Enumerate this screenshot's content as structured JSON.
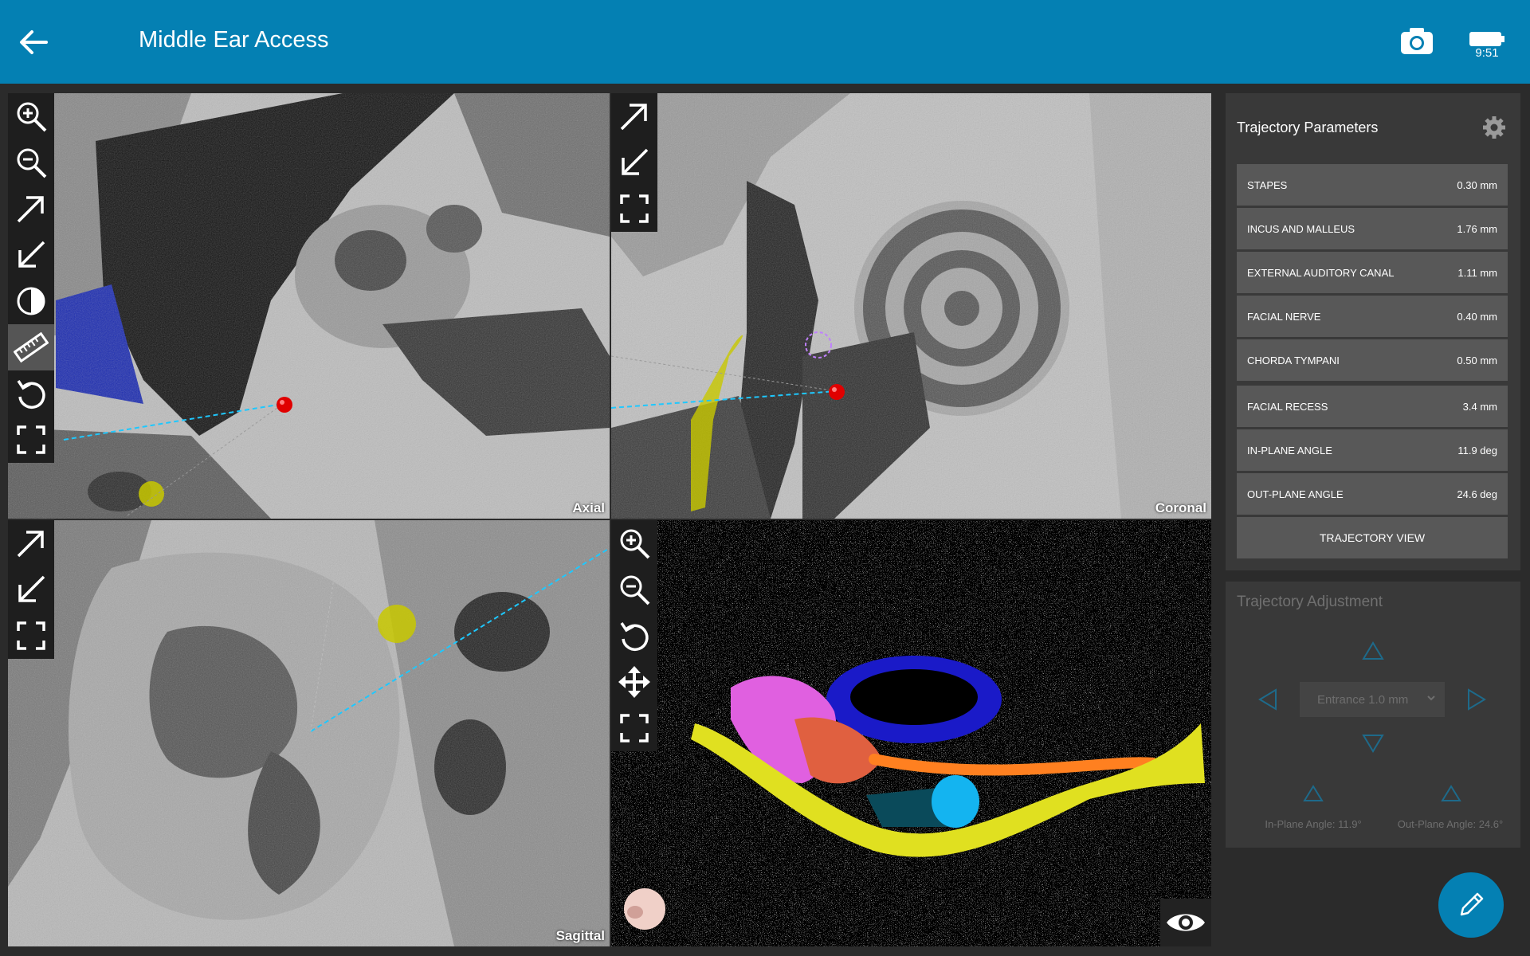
{
  "header": {
    "title": "Middle Ear Access",
    "time": "9:51",
    "back_icon": "arrow-left-icon",
    "camera_icon": "camera-icon",
    "battery_icon": "battery-icon"
  },
  "views": {
    "axial": {
      "label": "Axial"
    },
    "coronal": {
      "label": "Coronal"
    },
    "sagittal": {
      "label": "Sagittal"
    }
  },
  "trajectory_parameters": {
    "title": "Trajectory Parameters",
    "rows": [
      {
        "name": "STAPES",
        "value": "0.30 mm"
      },
      {
        "name": "INCUS AND MALLEUS",
        "value": "1.76 mm"
      },
      {
        "name": "EXTERNAL AUDITORY CANAL",
        "value": "1.11 mm"
      },
      {
        "name": "FACIAL NERVE",
        "value": "0.40 mm"
      },
      {
        "name": "CHORDA TYMPANI",
        "value": "0.50 mm"
      },
      {
        "name": "FACIAL RECESS",
        "value": "3.4 mm"
      },
      {
        "name": "IN-PLANE ANGLE",
        "value": "11.9 deg"
      },
      {
        "name": "OUT-PLANE ANGLE",
        "value": "24.6 deg"
      }
    ],
    "button": "TRAJECTORY VIEW"
  },
  "trajectory_adjustment": {
    "title": "Trajectory Adjustment",
    "select_value": "Entrance 1.0 mm",
    "in_plane_label": "In-Plane Angle: 11.9°",
    "out_plane_label": "Out-Plane Angle: 24.6°"
  },
  "colors": {
    "accent": "#0480b3",
    "trajectory": "#1ec8ff",
    "marker": "#e00000",
    "nerve": "#e0e020"
  }
}
